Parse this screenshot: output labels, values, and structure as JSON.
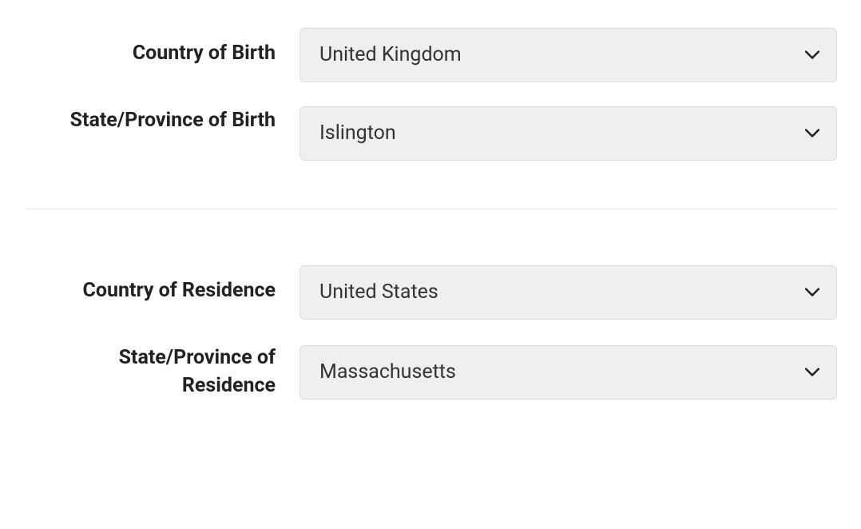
{
  "birth": {
    "country_label": "Country of Birth",
    "country_value": "United Kingdom",
    "state_label": "State/Province of Birth",
    "state_value": "Islington"
  },
  "residence": {
    "country_label": "Country of Residence",
    "country_value": "United States",
    "state_label": "State/Province of Residence",
    "state_value": "Massachusetts"
  }
}
